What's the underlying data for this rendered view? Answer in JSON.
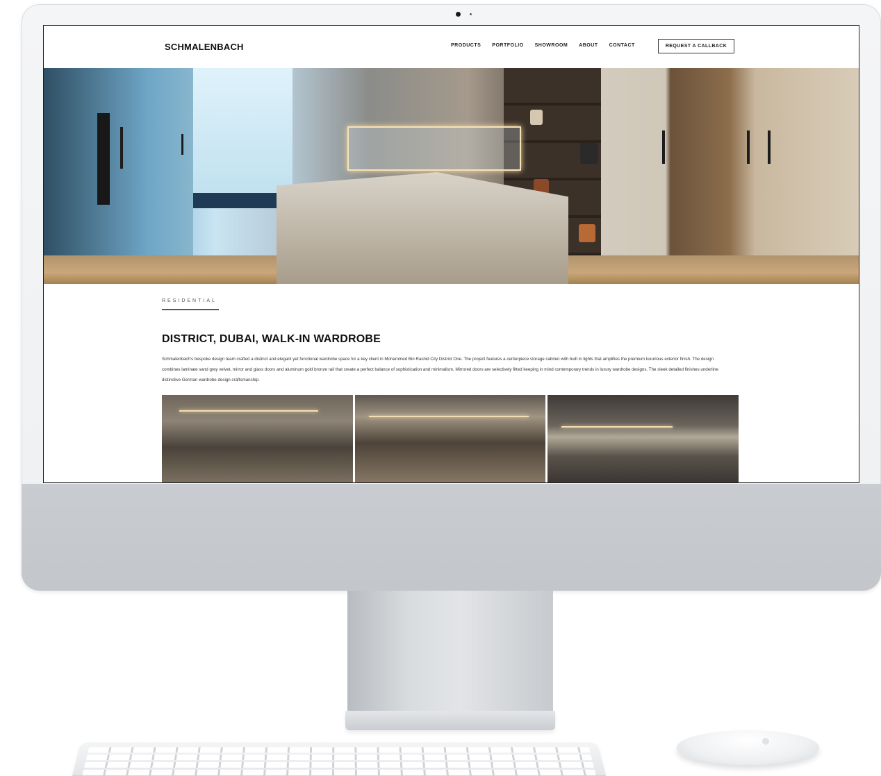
{
  "site": {
    "brand": "SCHMALENBACH",
    "nav": [
      "PRODUCTS",
      "PORTFOLIO",
      "SHOWROOM",
      "ABOUT",
      "CONTACT"
    ],
    "cta": "REQUEST A CALLBACK"
  },
  "project": {
    "category": "RESIDENTIAL",
    "title": "DISTRICT, DUBAI, WALK-IN WARDROBE",
    "description": "Schmalenbach's bespoke design team crafted a distinct and elegant yet functional wardrobe space for a key client in Mohammed Bin Rashid City District One. The project features a centerpiece storage cabinet with built in lights that amplifies the premium luxurious exterior finish. The design combines laminate sand grey velvet, mirror and glass doors and aluminum gold bronze rail that create a perfect balance of sophistication and minimalism. Mirrored doors are selectively fitted keeping in mind contemporary trends in luxury wardrobe designs. The sleek detailed finishes underline distinctive German wardrobe design craftsmanship."
  },
  "colors": {
    "text": "#111111",
    "device_silver": "#c6c9cd",
    "screen_bezel": "#202020"
  }
}
